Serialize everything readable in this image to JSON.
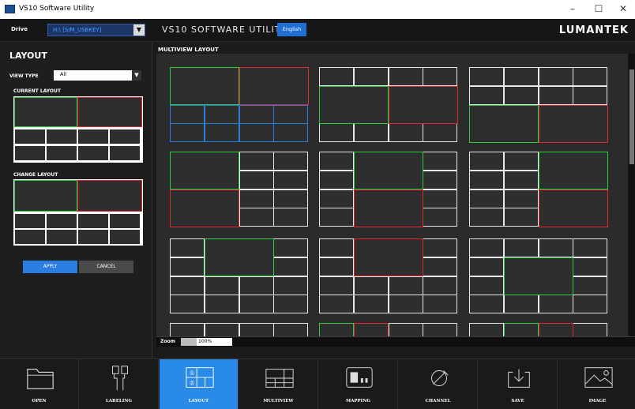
{
  "window": {
    "title": "VS10 Software Utility",
    "controls": [
      "–",
      "☐",
      "✕"
    ]
  },
  "topbar": {
    "drive_label": "Drive",
    "drive_value": "H:\\ [SIM_USBKEY]",
    "app_title": "VS10 SOFTWARE UTILITY",
    "language": "English",
    "brand": "LUMANTEK"
  },
  "layout_panel": {
    "title": "LAYOUT",
    "view_type_label": "VIEW TYPE",
    "view_type_value": "All",
    "current_layout_label": "CURRENT LAYOUT",
    "change_layout_label": "CHANGE LAYOUT",
    "apply_label": "APPLY",
    "cancel_label": "CANCEL"
  },
  "multiview": {
    "title": "MULTIVIEW LAYOUT",
    "zoom_label": "Zoom",
    "zoom_value": "100%"
  },
  "toolbar": {
    "items": [
      {
        "label": "OPEN",
        "icon": "folder-icon"
      },
      {
        "label": "LABELING",
        "icon": "cable-icon"
      },
      {
        "label": "LAYOUT",
        "icon": "layout-grid-icon"
      },
      {
        "label": "MULTIVIEW",
        "icon": "multiview-icon"
      },
      {
        "label": "MAPPING",
        "icon": "mapping-icon"
      },
      {
        "label": "CHANNEL",
        "icon": "channel-icon"
      },
      {
        "label": "SAVE",
        "icon": "save-icon"
      },
      {
        "label": "IMAGE",
        "icon": "image-icon"
      }
    ],
    "active_index": 2,
    "active_color": "#2a8ae8"
  },
  "colors": {
    "accent": "#2a7de1",
    "green": "#2ecc40",
    "red": "#e0282f",
    "blue": "#2a7de1",
    "yellow": "#c9b53a"
  }
}
